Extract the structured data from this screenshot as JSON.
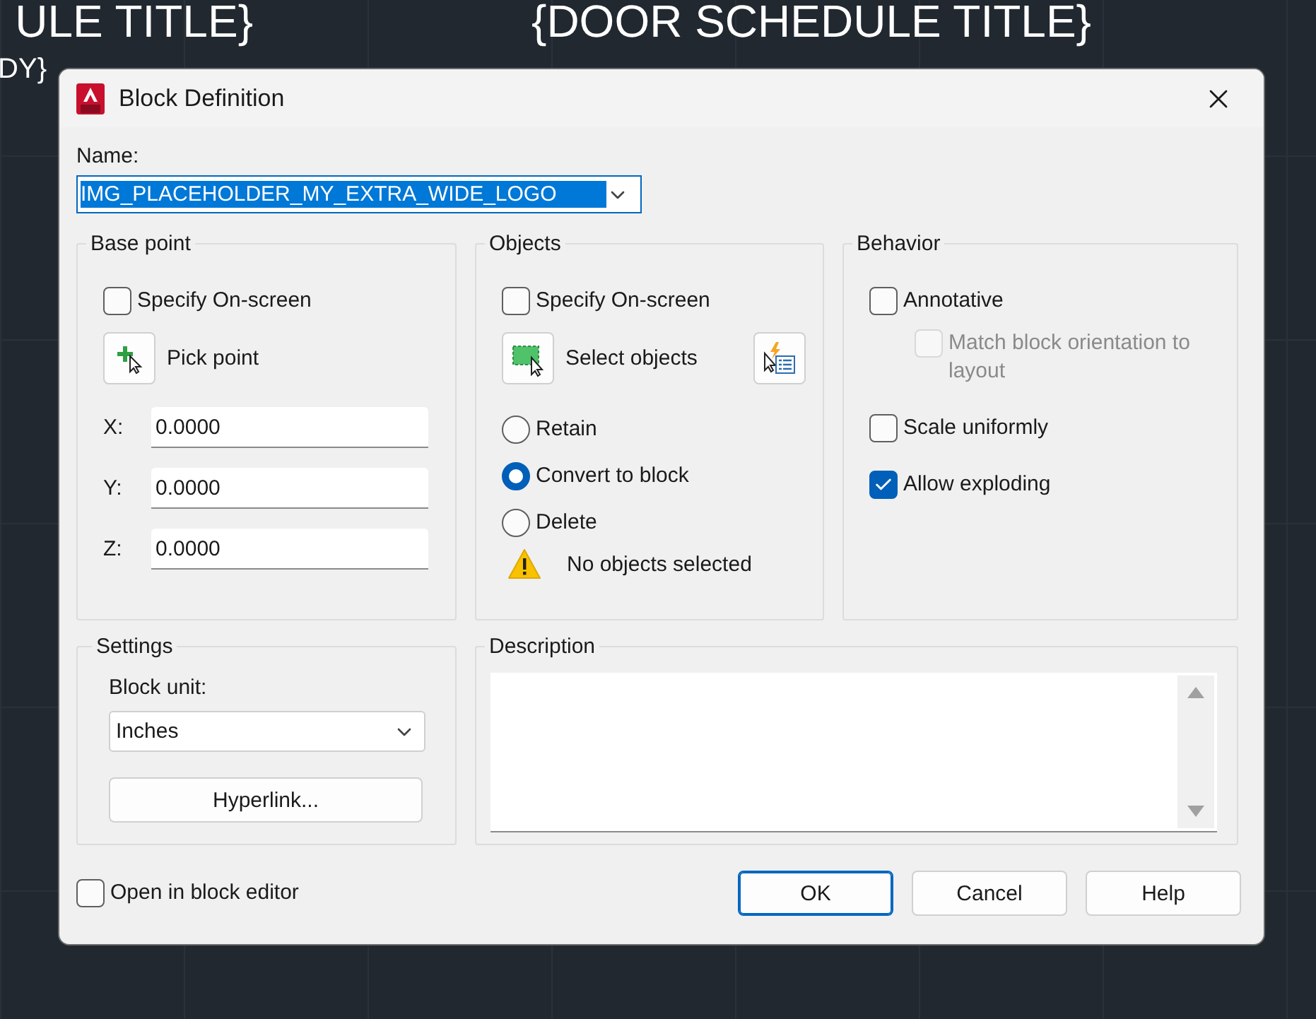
{
  "canvas": {
    "left": [
      {
        "text": "ULE TITLE}",
        "kind": "title"
      },
      {
        "text": "DY}",
        "kind": "body"
      }
    ],
    "right": [
      {
        "text": "{DOOR SCHEDULE TITLE}",
        "kind": "title"
      }
    ]
  },
  "window": {
    "title": "Block Definition"
  },
  "name": {
    "label": "Name:",
    "value": "IMG_PLACEHOLDER_MY_EXTRA_WIDE_LOGO",
    "selected": true
  },
  "base_point": {
    "title": "Base point",
    "specify_on_screen": {
      "label": "Specify On-screen",
      "checked": false
    },
    "pick_button": "Pick point",
    "coords": [
      {
        "label": "X:",
        "value": "0.0000"
      },
      {
        "label": "Y:",
        "value": "0.0000"
      },
      {
        "label": "Z:",
        "value": "0.0000"
      }
    ]
  },
  "objects": {
    "title": "Objects",
    "specify_on_screen": {
      "label": "Specify On-screen",
      "checked": false
    },
    "select_button": "Select objects",
    "options": [
      {
        "label": "Retain",
        "selected": false
      },
      {
        "label": "Convert to block",
        "selected": true
      },
      {
        "label": "Delete",
        "selected": false
      }
    ],
    "warning": "No objects selected"
  },
  "behavior": {
    "title": "Behavior",
    "options": [
      {
        "label": "Annotative",
        "checked": false,
        "disabled": false,
        "children": [
          {
            "label": "Match block orientation to layout",
            "checked": false,
            "disabled": true
          }
        ]
      },
      {
        "label": "Scale uniformly",
        "checked": false,
        "disabled": false
      },
      {
        "label": "Allow exploding",
        "checked": true,
        "disabled": false
      }
    ]
  },
  "settings": {
    "title": "Settings",
    "unit_label": "Block unit:",
    "unit_value": "Inches",
    "hyperlink_button": "Hyperlink..."
  },
  "description": {
    "title": "Description"
  },
  "open_in_editor": {
    "label": "Open in block editor",
    "checked": false
  },
  "buttons": [
    {
      "label": "OK",
      "kind": "default"
    },
    {
      "label": "Cancel",
      "kind": "normal"
    },
    {
      "label": "Help",
      "kind": "normal"
    }
  ]
}
